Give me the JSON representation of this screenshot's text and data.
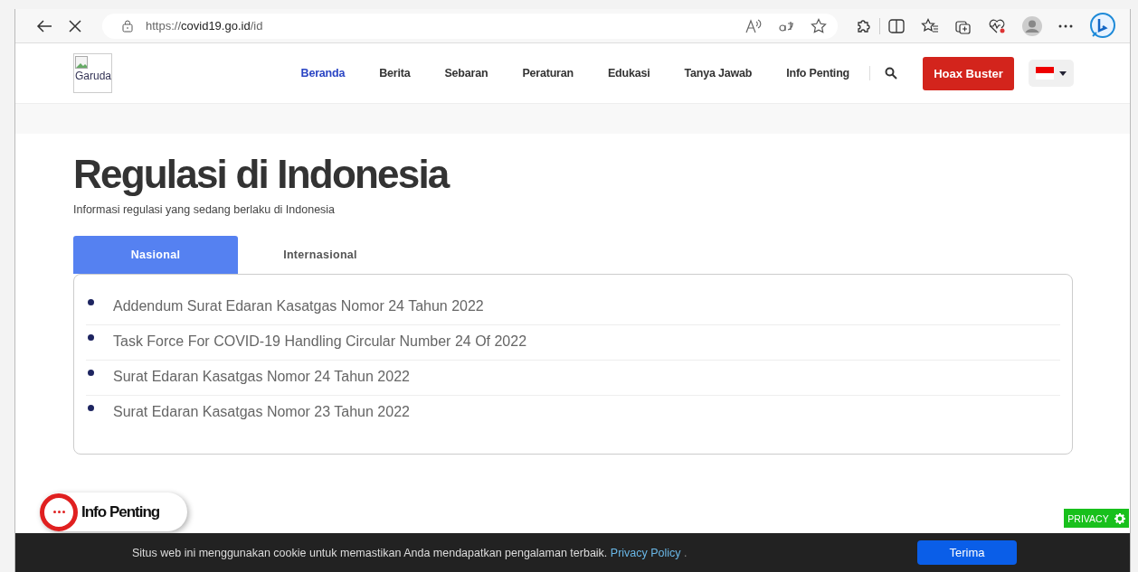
{
  "browser": {
    "url_host": "https://",
    "url_domain": "covid19.go.id",
    "url_path": "/id",
    "loading": true
  },
  "header": {
    "logo_alt": "Garuda",
    "nav": [
      {
        "label": "Beranda",
        "selected": true
      },
      {
        "label": "Berita",
        "selected": false
      },
      {
        "label": "Sebaran",
        "selected": false
      },
      {
        "label": "Peraturan",
        "selected": false
      },
      {
        "label": "Edukasi",
        "selected": false
      },
      {
        "label": "Tanya Jawab",
        "selected": false
      },
      {
        "label": "Info Penting",
        "selected": false
      }
    ],
    "cta": "Hoax Buster"
  },
  "page": {
    "title": "Regulasi di Indonesia",
    "subtitle": "Informasi regulasi yang sedang berlaku di Indonesia",
    "tabs": [
      {
        "label": "Nasional",
        "selected": true
      },
      {
        "label": "Internasional",
        "selected": false
      }
    ],
    "items": [
      "Addendum Surat Edaran Kasatgas Nomor 24 Tahun 2022",
      "Task Force For COVID-19 Handling Circular Number 24 Of 2022",
      "Surat Edaran Kasatgas Nomor 24 Tahun 2022",
      "Surat Edaran Kasatgas Nomor 23 Tahun 2022"
    ]
  },
  "info_button": {
    "label": "Info Penting"
  },
  "privacy_badge": {
    "label": "PRIVACY"
  },
  "cookie_bar": {
    "text": "Situs web ini menggunakan cookie untuk memastikan Anda mendapatkan pengalaman terbaik.",
    "link": "Privacy Policy",
    "trailing": ".",
    "button": "Terima"
  }
}
